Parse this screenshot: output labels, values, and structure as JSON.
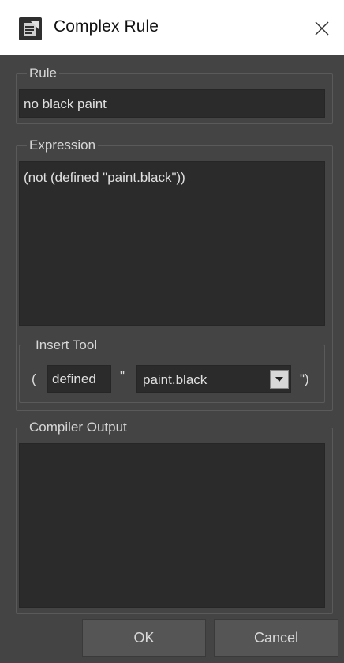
{
  "window": {
    "title": "Complex Rule",
    "app_icon": "app-logo-icon",
    "close_icon": "close-icon"
  },
  "rule": {
    "label": "Rule",
    "value": "no black paint"
  },
  "expression": {
    "label": "Expression",
    "value": "(not (defined \"paint.black\"))"
  },
  "insert_tool": {
    "label": "Insert Tool",
    "open_paren": "(",
    "function_button": "defined",
    "open_quote": "\"",
    "selected_value": "paint.black",
    "close_quote": "\")",
    "dropdown_icon": "chevron-down-icon"
  },
  "compiler_output": {
    "label": "Compiler Output",
    "value": ""
  },
  "buttons": {
    "ok": "OK",
    "cancel": "Cancel"
  },
  "colors": {
    "background": "#444444",
    "field": "#2b2b2b",
    "titlebar": "#ffffff"
  }
}
